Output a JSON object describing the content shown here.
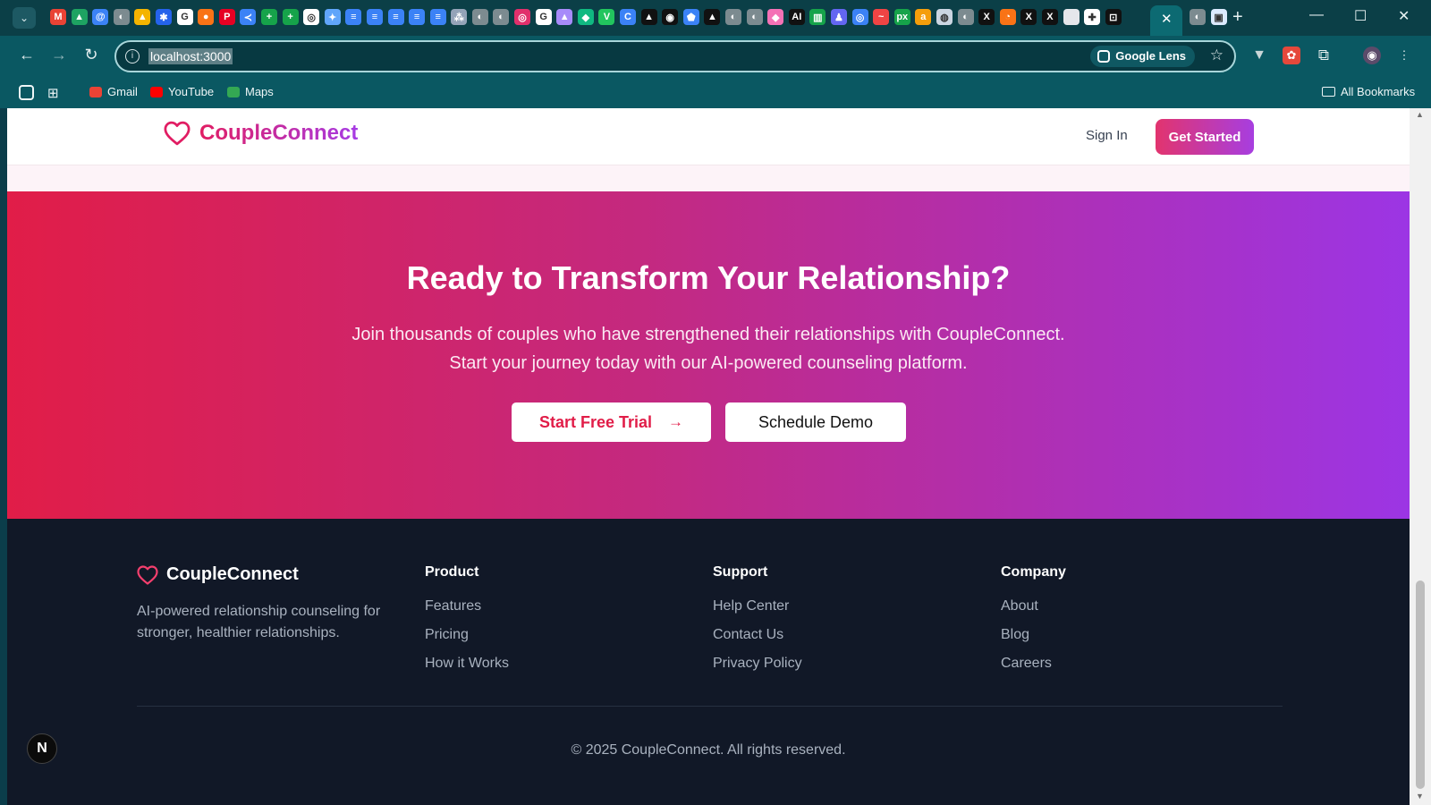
{
  "browser": {
    "tab_strip": {
      "active_tab_close": "✕",
      "new_tab": "+",
      "favicons": [
        {
          "name": "gmail-icon",
          "color": "#e94335",
          "glyph": "M"
        },
        {
          "name": "drive-icon",
          "color": "#1ea362",
          "glyph": "▲"
        },
        {
          "name": "proton-icon",
          "color": "#3b82f6",
          "glyph": "@"
        },
        {
          "name": "globe-icon",
          "color": "#7c8b90",
          "glyph": "◐"
        },
        {
          "name": "drive-icon-2",
          "color": "#f4b400",
          "glyph": "▲"
        },
        {
          "name": "dropbox-icon",
          "color": "#2563eb",
          "glyph": "✱"
        },
        {
          "name": "google-icon",
          "color": "#ffffff",
          "glyph": "G"
        },
        {
          "name": "firebase-icon",
          "color": "#f97316",
          "glyph": "●"
        },
        {
          "name": "pinterest-icon",
          "color": "#e60023",
          "glyph": "P"
        },
        {
          "name": "vscode-icon",
          "color": "#3b82f6",
          "glyph": "≺"
        },
        {
          "name": "sheets-icon",
          "color": "#16a34a",
          "glyph": "+"
        },
        {
          "name": "sheets-icon-2",
          "color": "#16a34a",
          "glyph": "+"
        },
        {
          "name": "openai-icon",
          "color": "#ffffff",
          "glyph": "◎"
        },
        {
          "name": "gemini-icon",
          "color": "#60a5fa",
          "glyph": "✦"
        },
        {
          "name": "docs-icon",
          "color": "#3b82f6",
          "glyph": "≡"
        },
        {
          "name": "docs-icon-2",
          "color": "#3b82f6",
          "glyph": "≡"
        },
        {
          "name": "docs-icon-3",
          "color": "#3b82f6",
          "glyph": "≡"
        },
        {
          "name": "docs-icon-4",
          "color": "#3b82f6",
          "glyph": "≡"
        },
        {
          "name": "docs-icon-5",
          "color": "#3b82f6",
          "glyph": "≡"
        },
        {
          "name": "tree-icon",
          "color": "#94a3b8",
          "glyph": "⁂"
        },
        {
          "name": "globe-icon-2",
          "color": "#7c8b90",
          "glyph": "◐"
        },
        {
          "name": "globe-icon-3",
          "color": "#7c8b90",
          "glyph": "◐"
        },
        {
          "name": "instagram-icon",
          "color": "#e1306c",
          "glyph": "◎"
        },
        {
          "name": "google-icon-2",
          "color": "#ffffff",
          "glyph": "G"
        },
        {
          "name": "arc-icon",
          "color": "#a78bfa",
          "glyph": "▲"
        },
        {
          "name": "diamond-icon",
          "color": "#10b981",
          "glyph": "◆"
        },
        {
          "name": "vuetify-icon",
          "color": "#22c55e",
          "glyph": "V"
        },
        {
          "name": "circle-c-icon",
          "color": "#3b82f6",
          "glyph": "C"
        },
        {
          "name": "notion-icon",
          "color": "#111111",
          "glyph": "▲"
        },
        {
          "name": "github-icon",
          "color": "#111111",
          "glyph": "◉"
        },
        {
          "name": "shield-icon",
          "color": "#3b82f6",
          "glyph": "⬟"
        },
        {
          "name": "vercel-icon",
          "color": "#111111",
          "glyph": "▲"
        },
        {
          "name": "globe-icon-4",
          "color": "#7c8b90",
          "glyph": "◐"
        },
        {
          "name": "globe-icon-5",
          "color": "#7c8b90",
          "glyph": "◐"
        },
        {
          "name": "figma-icon",
          "color": "#f472b6",
          "glyph": "◆"
        },
        {
          "name": "ai-icon",
          "color": "#111111",
          "glyph": "AI"
        },
        {
          "name": "bar-icon",
          "color": "#16a34a",
          "glyph": "▥"
        },
        {
          "name": "character-icon",
          "color": "#6366f1",
          "glyph": "♟"
        },
        {
          "name": "ring-icon",
          "color": "#3b82f6",
          "glyph": "◎"
        },
        {
          "name": "dash-icon",
          "color": "#ef4444",
          "glyph": "~"
        },
        {
          "name": "px-icon",
          "color": "#16a34a",
          "glyph": "px"
        },
        {
          "name": "amazon-icon",
          "color": "#f59e0b",
          "glyph": "a"
        },
        {
          "name": "chatgpt-icon",
          "color": "#cbd5e1",
          "glyph": "◍"
        },
        {
          "name": "globe-icon-6",
          "color": "#7c8b90",
          "glyph": "◐"
        },
        {
          "name": "x-icon",
          "color": "#111111",
          "glyph": "X"
        },
        {
          "name": "clock-icon",
          "color": "#f97316",
          "glyph": "◔"
        },
        {
          "name": "x-icon-2",
          "color": "#111111",
          "glyph": "X"
        },
        {
          "name": "x-icon-3",
          "color": "#111111",
          "glyph": "X"
        },
        {
          "name": "blank-tab-icon",
          "color": "#e5e7eb",
          "glyph": ""
        },
        {
          "name": "pinwheel-icon",
          "color": "#ffffff",
          "glyph": "✚"
        },
        {
          "name": "bracket-icon",
          "color": "#111111",
          "glyph": "⊡"
        }
      ],
      "after_active": [
        {
          "name": "globe-icon-7",
          "color": "#7c8b90",
          "glyph": "◐"
        },
        {
          "name": "image-icon",
          "color": "#dbeafe",
          "glyph": "▣"
        }
      ]
    },
    "toolbar": {
      "url": "localhost:3000",
      "lens_label": "Google Lens"
    },
    "bookmarks": {
      "items": [
        {
          "label": "Gmail",
          "color": "#ea4335"
        },
        {
          "label": "YouTube",
          "color": "#ff0000"
        },
        {
          "label": "Maps",
          "color": "#34a853"
        }
      ],
      "all_bookmarks": "All Bookmarks"
    }
  },
  "site": {
    "brand": "CoupleConnect",
    "nav": {
      "sign_in": "Sign In",
      "get_started": "Get Started"
    },
    "cta": {
      "title": "Ready to Transform Your Relationship?",
      "subtitle_line1": "Join thousands of couples who have strengthened their relationships with CoupleConnect.",
      "subtitle_line2": "Start your journey today with our AI-powered counseling platform.",
      "primary_button": "Start Free Trial",
      "secondary_button": "Schedule Demo"
    },
    "footer": {
      "brand": "CoupleConnect",
      "description": "AI-powered relationship counseling for stronger, healthier relationships.",
      "columns": [
        {
          "heading": "Product",
          "links": [
            "Features",
            "Pricing",
            "How it Works"
          ]
        },
        {
          "heading": "Support",
          "links": [
            "Help Center",
            "Contact Us",
            "Privacy Policy"
          ]
        },
        {
          "heading": "Company",
          "links": [
            "About",
            "Blog",
            "Careers"
          ]
        }
      ],
      "copyright": "© 2025 CoupleConnect. All rights reserved."
    },
    "dev_badge": "N"
  },
  "colors": {
    "brand_pink": "#e11d48",
    "brand_purple": "#9c35e4",
    "footer_bg": "#111827"
  }
}
